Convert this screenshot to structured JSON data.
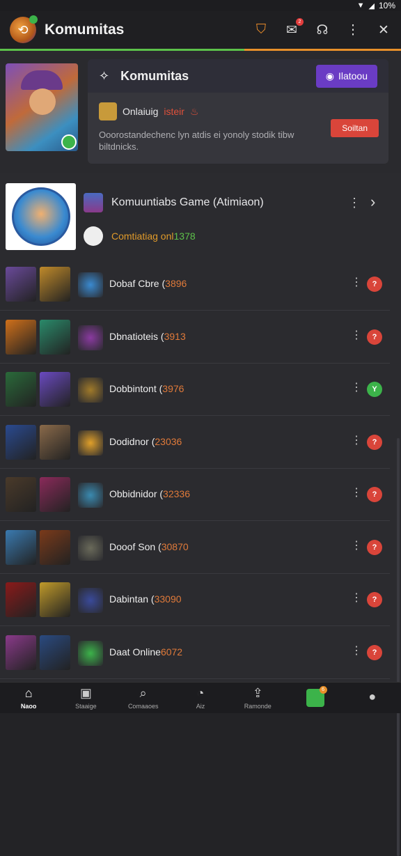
{
  "status": {
    "battery": "10%"
  },
  "app": {
    "title": "Komumitas",
    "icons": [
      "bookmark-icon",
      "mail-icon",
      "headset-icon",
      "more-icon",
      "tools-icon"
    ],
    "mail_badge": "2"
  },
  "progress": {
    "value": 0.61,
    "colors": {
      "fill": "#5cc24a",
      "track": "#e8902a"
    }
  },
  "banner": {
    "title": "Komumitas",
    "join_label": "Ilatoou",
    "online_label": "Onlaiuig",
    "online_sub": "isteir",
    "description": "Ooorostandechenc lyn atdis ei yonoly stodik tibw biltdnicks.",
    "see_label": "Soiltan"
  },
  "featured": {
    "title": "Komuuntiabs Game (Atimiaon)",
    "sub_label": "Comtiatiag onl",
    "sub_num": "1378"
  },
  "rows": [
    {
      "name": "Dobaf Cbre (",
      "num": "3896",
      "status": "?",
      "color": "#d9453a",
      "c1": "#6a4a9a",
      "c2": "#c08a2a",
      "c3": "#3a8ad0"
    },
    {
      "name": "Dbnatioteis (",
      "num": "3913",
      "status": "?",
      "color": "#d9453a",
      "c1": "#d0701a",
      "c2": "#2a8a6a",
      "c3": "#8a3aa0"
    },
    {
      "name": "Dobbintont (",
      "num": "3976",
      "status": "Y",
      "color": "#3cb34a",
      "c1": "#2a6a3a",
      "c2": "#6a4ac0",
      "c3": "#a07a2a"
    },
    {
      "name": "Dodidnor (",
      "num": "23036",
      "status": "?",
      "color": "#d9453a",
      "c1": "#2a4a90",
      "c2": "#8a6a4a",
      "c3": "#e0a02a"
    },
    {
      "name": "Obbidnidor (",
      "num": "32336",
      "status": "?",
      "color": "#d9453a",
      "c1": "#4a3a2a",
      "c2": "#8a2a5a",
      "c3": "#3a8ab0"
    },
    {
      "name": "Dooof Son (",
      "num": "30870",
      "status": "?",
      "color": "#d9453a",
      "c1": "#3a7ab0",
      "c2": "#7a3a1a",
      "c3": "#6a6a5a"
    },
    {
      "name": "Dabintan (",
      "num": "33090",
      "status": "?",
      "color": "#d9453a",
      "c1": "#8a1a1a",
      "c2": "#c09a2a",
      "c3": "#3a4a9a"
    },
    {
      "name": "Daat Online",
      "num": "6072",
      "status": "?",
      "color": "#d9453a",
      "c1": "#8a3a8a",
      "c2": "#2a4a80",
      "c3": "#3cb34a"
    }
  ],
  "nav": [
    {
      "label": "Naoo",
      "icon": "home-icon",
      "glyph": "⌂",
      "active": true
    },
    {
      "label": "Staaige",
      "icon": "list-icon",
      "glyph": "▣",
      "active": false
    },
    {
      "label": "Comaaoes",
      "icon": "search-icon",
      "glyph": "⌕",
      "active": false
    },
    {
      "label": "Aiz",
      "icon": "compass-icon",
      "glyph": "◔",
      "active": false
    },
    {
      "label": "Ramonde",
      "icon": "share-icon",
      "glyph": "⇪",
      "active": false
    },
    {
      "label": "",
      "icon": "game-icon",
      "glyph": "",
      "active": false
    },
    {
      "label": "",
      "icon": "profile-icon",
      "glyph": "●",
      "active": false
    }
  ]
}
